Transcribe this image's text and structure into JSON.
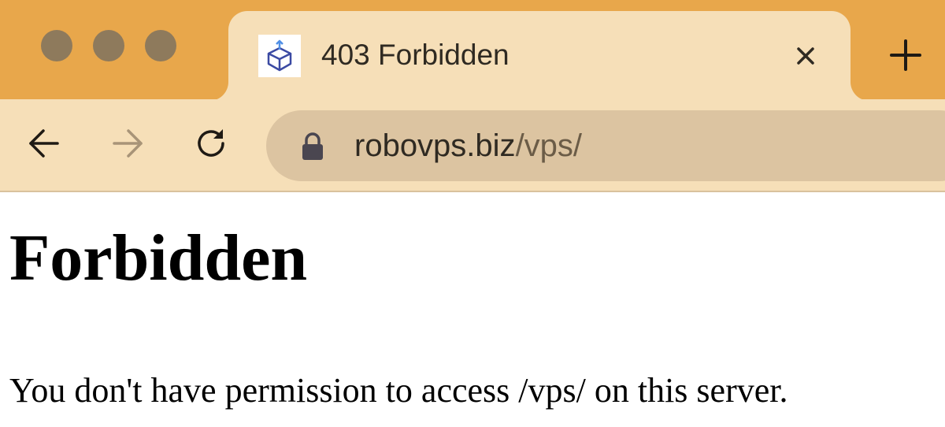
{
  "browser": {
    "tab": {
      "title": "403 Forbidden",
      "favicon": "box-upload-icon"
    },
    "address_bar": {
      "host": "robovps.biz",
      "path": "/vps/"
    },
    "icons": {
      "back": "arrow-left-icon",
      "forward": "arrow-right-icon",
      "reload": "reload-icon",
      "lock": "lock-icon",
      "close_tab": "close-icon",
      "new_tab": "plus-icon"
    },
    "colors": {
      "titlebar": "#e8a74b",
      "toolbar": "#f6dfb8",
      "omnibox": "#dcc4a1"
    }
  },
  "page": {
    "heading": "Forbidden",
    "message": "You don't have permission to access /vps/ on this server."
  }
}
